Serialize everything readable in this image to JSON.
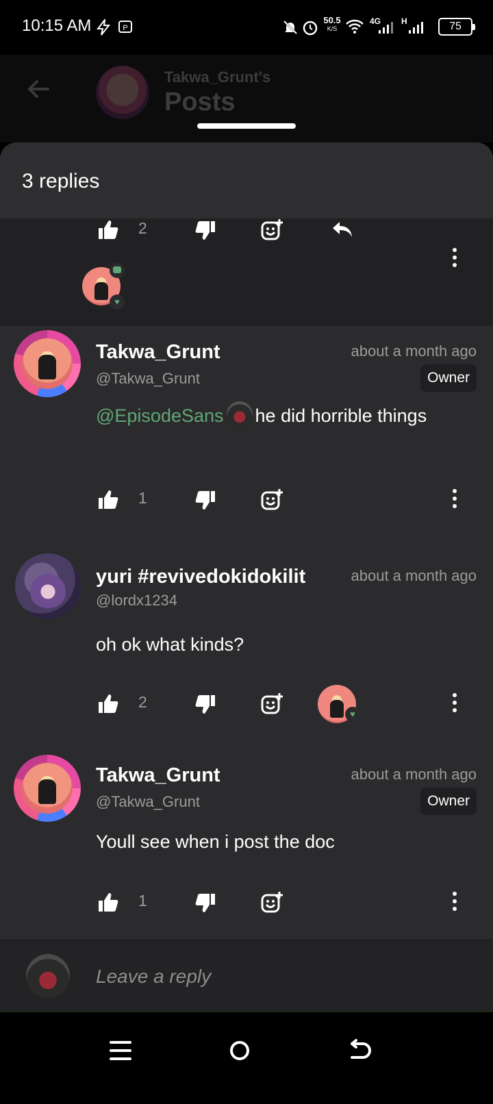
{
  "status_bar": {
    "time": "10:15 AM",
    "net_speed_value": "50.5",
    "net_speed_unit": "K/S",
    "network_4g": "4G",
    "network_h": "H",
    "battery": "75"
  },
  "header": {
    "subtitle": "Takwa_Grunt's",
    "title": "Posts"
  },
  "sheet": {
    "title": "3 replies"
  },
  "parent": {
    "likes": "2"
  },
  "replies": [
    {
      "username": "Takwa_Grunt",
      "handle": "@Takwa_Grunt",
      "timestamp": "about a month ago",
      "badge": "Owner",
      "mention": "@EpisodeSans",
      "text": "he did horrible things",
      "likes": "1"
    },
    {
      "username": "yuri #revivedokidokilit",
      "handle": "@lordx1234",
      "timestamp": "about a month ago",
      "text": "oh ok what kinds?",
      "likes": "2"
    },
    {
      "username": "Takwa_Grunt",
      "handle": "@Takwa_Grunt",
      "timestamp": "about a month ago",
      "badge": "Owner",
      "text": "Youll see when i post the doc",
      "likes": "1"
    }
  ],
  "reply_box": {
    "placeholder": "Leave a reply"
  },
  "colors": {
    "sheet_bg": "#2b2a2c",
    "mention": "#5fa777",
    "muted_text": "#9c9c9c"
  }
}
